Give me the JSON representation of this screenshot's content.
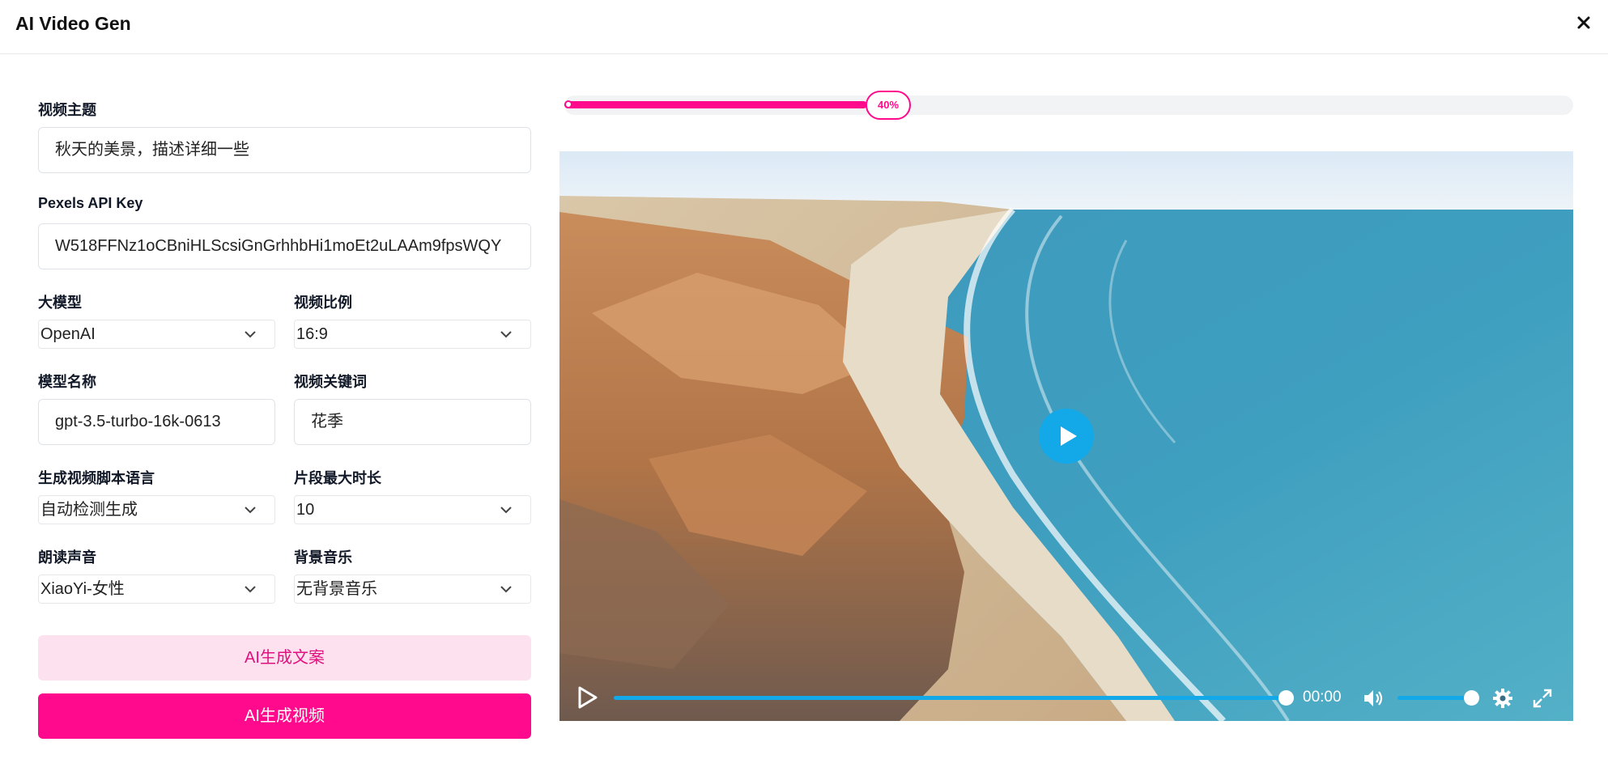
{
  "app": {
    "title": "AI Video Gen"
  },
  "form": {
    "topic": {
      "label": "视频主题",
      "value": "秋天的美景，描述详细一些"
    },
    "pexels_key": {
      "label": "Pexels API Key",
      "value": "W518FFNz1oCBniHLScsiGnGrhhbHi1moEt2uLAAm9fpsWQY"
    },
    "llm": {
      "label": "大模型",
      "value": "OpenAI"
    },
    "aspect": {
      "label": "视频比例",
      "value": "16:9"
    },
    "model_name": {
      "label": "模型名称",
      "value": "gpt-3.5-turbo-16k-0613"
    },
    "keywords": {
      "label": "视频关键词",
      "value": "花季"
    },
    "script_lang": {
      "label": "生成视频脚本语言",
      "value": "自动检测生成"
    },
    "clip_duration": {
      "label": "片段最大时长",
      "value": "10"
    },
    "voice": {
      "label": "朗读声音",
      "value": "XiaoYi-女性"
    },
    "bgm": {
      "label": "背景音乐",
      "value": "无背景音乐"
    },
    "gen_script_label": "AI生成文案",
    "gen_video_label": "AI生成视频"
  },
  "progress": {
    "percent_label": "40%",
    "value": 0.4
  },
  "player": {
    "time": "00:00",
    "seek_fraction": 1.0,
    "volume_fraction": 1.0
  },
  "colors": {
    "accent": "#ff0a8c",
    "accent_light": "#fde1ef",
    "player": "#13a8e8"
  },
  "icons": [
    "close-icon",
    "chevron-down-icon",
    "play-icon",
    "volume-icon",
    "gear-icon",
    "fullscreen-icon"
  ]
}
